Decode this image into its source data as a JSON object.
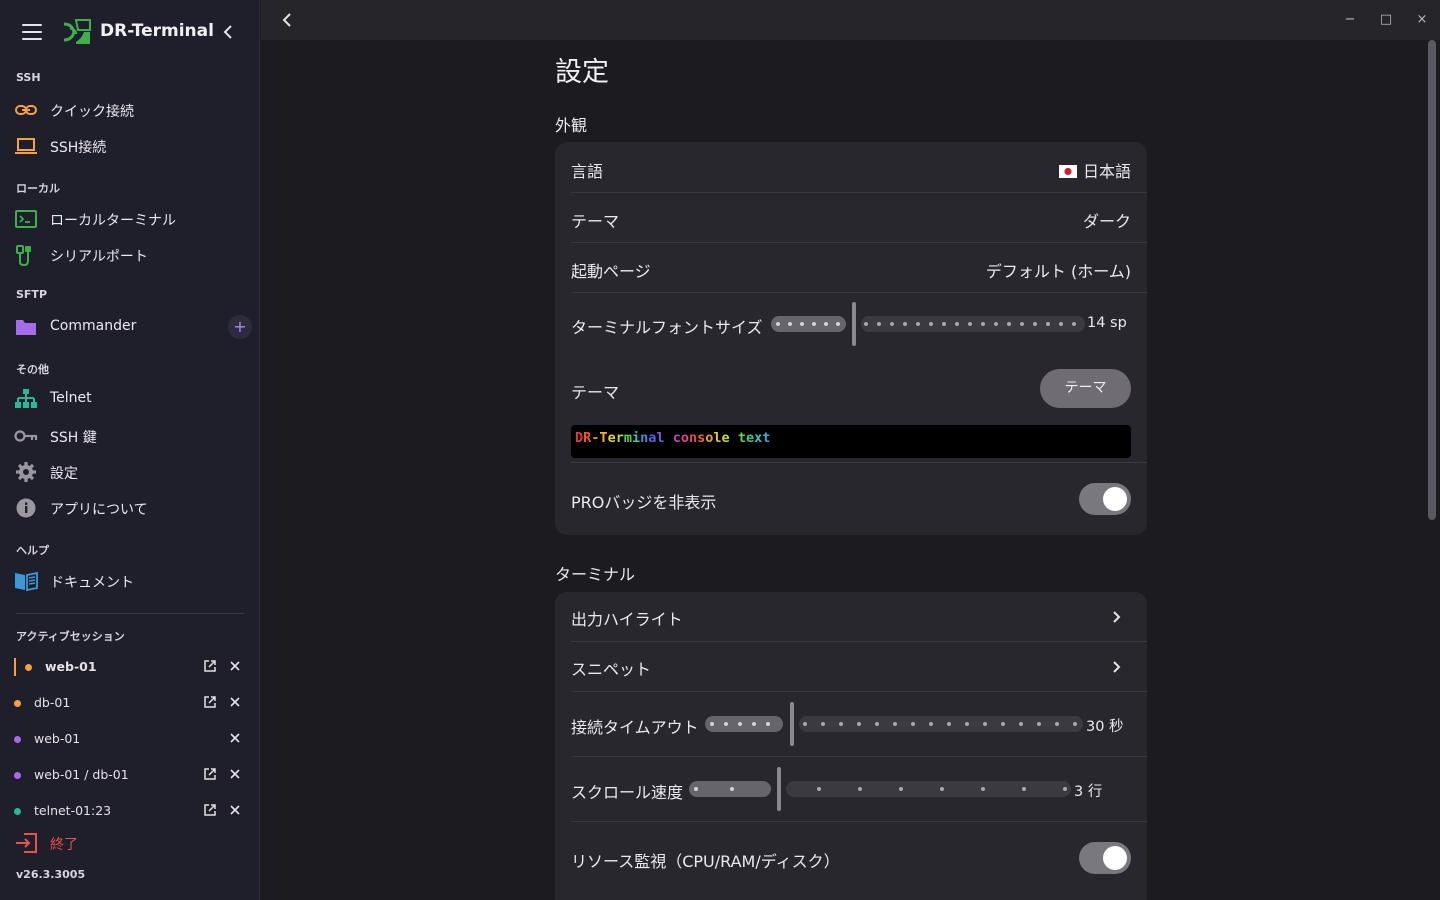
{
  "app": {
    "title": "DR-Terminal",
    "version": "v26.3.3005"
  },
  "sidebar": {
    "sections": {
      "ssh": "SSH",
      "local": "ローカル",
      "sftp": "SFTP",
      "other": "その他",
      "help": "ヘルプ",
      "sessions": "アクティブセッション"
    },
    "items": {
      "quick_connect": "クイック接続",
      "ssh_connect": "SSH接続",
      "local_terminal": "ローカルターミナル",
      "serial_port": "シリアルポート",
      "commander": "Commander",
      "commander_add": "+",
      "telnet": "Telnet",
      "ssh_key": "SSH 鍵",
      "settings": "設定",
      "about": "アプリについて",
      "docs": "ドキュメント"
    },
    "sessions": [
      {
        "name": "web-01",
        "color": "#f5a142",
        "active": true,
        "external": true
      },
      {
        "name": "db-01",
        "color": "#f5a142",
        "active": false,
        "external": true
      },
      {
        "name": "web-01",
        "color": "#a66be8",
        "active": false,
        "external": false
      },
      {
        "name": "web-01 / db-01",
        "color": "#a66be8",
        "active": false,
        "external": true
      },
      {
        "name": "telnet-01:23",
        "color": "#27b89a",
        "active": false,
        "external": true
      }
    ],
    "quit": "終了"
  },
  "window": {
    "minimize": "−",
    "maximize": "□",
    "close": "×"
  },
  "settings": {
    "title": "設定",
    "appearance": {
      "title": "外観",
      "language_label": "言語",
      "language_value": "日本語",
      "theme_label": "テーマ",
      "theme_value": "ダーク",
      "startup_label": "起動ページ",
      "startup_value": "デフォルト (ホーム)",
      "font_size_label": "ターミナルフォントサイズ",
      "font_size_value": "14 sp",
      "terminal_theme_label": "テーマ",
      "terminal_theme_button": "テーマ",
      "hide_pro_label": "PROバッジを非表示",
      "hide_pro_on": true
    },
    "console_preview": [
      {
        "t": "D",
        "c": "#e03c3c"
      },
      {
        "t": "R",
        "c": "#e8573a"
      },
      {
        "t": "-",
        "c": "#ef8a32"
      },
      {
        "t": "T",
        "c": "#f2b134"
      },
      {
        "t": "e",
        "c": "#e8d23a"
      },
      {
        "t": "r",
        "c": "#b5d838"
      },
      {
        "t": "m",
        "c": "#5fcf4a"
      },
      {
        "t": "i",
        "c": "#3fbfb0"
      },
      {
        "t": "n",
        "c": "#3a8fd8"
      },
      {
        "t": "a",
        "c": "#5566e0"
      },
      {
        "t": "l",
        "c": "#8a52d8"
      },
      {
        "t": " ",
        "c": "#ffffff"
      },
      {
        "t": "c",
        "c": "#b84bc4"
      },
      {
        "t": "o",
        "c": "#d84a8a"
      },
      {
        "t": "n",
        "c": "#e04a4a"
      },
      {
        "t": "s",
        "c": "#e86a3a"
      },
      {
        "t": "o",
        "c": "#ef9a32"
      },
      {
        "t": "l",
        "c": "#e8c43a"
      },
      {
        "t": "e",
        "c": "#c8d83a"
      },
      {
        "t": " ",
        "c": "#ffffff"
      },
      {
        "t": "t",
        "c": "#6acf48"
      },
      {
        "t": "e",
        "c": "#3fc98a"
      },
      {
        "t": "x",
        "c": "#3fbfc0"
      },
      {
        "t": "t",
        "c": "#3aa8d8"
      }
    ],
    "terminal": {
      "title": "ターミナル",
      "highlight_label": "出力ハイライト",
      "snippets_label": "スニペット",
      "timeout_label": "接続タイムアウト",
      "timeout_value": "30 秒",
      "scroll_label": "スクロール速度",
      "scroll_value": "3 行",
      "resource_label": "リソース監視（CPU/RAM/ディスク）",
      "resource_on": true
    }
  }
}
